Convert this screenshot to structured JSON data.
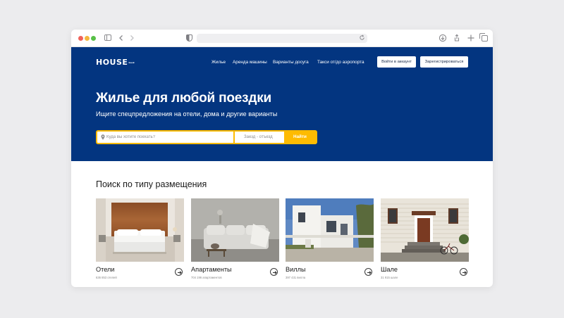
{
  "browser": {
    "icons": [
      "sidebar-icon",
      "back-icon",
      "forward-icon",
      "shield-icon",
      "reload-icon",
      "download-icon",
      "share-icon",
      "plus-icon",
      "tabs-icon"
    ]
  },
  "header": {
    "logo": "HOUSE",
    "logo_sub": "book",
    "nav": [
      "Жилье",
      "Аренда машины",
      "Варианты досуга",
      "Такси от/до аэропорта"
    ],
    "login_label": "Войти в аккаунт",
    "register_label": "Зарегистрироваться"
  },
  "hero": {
    "title": "Жилье для любой поездки",
    "subtitle": "Ищите спецпредложения на отели, дома и другие варианты"
  },
  "search": {
    "destination_placeholder": "Куда вы хотите поехать?",
    "destination_value": "",
    "dates_placeholder": "Заезд - отъезд",
    "button_label": "Найти"
  },
  "property_types": {
    "title": "Поиск по типу размещения",
    "items": [
      {
        "label": "Отели",
        "count": "636 853 отелей"
      },
      {
        "label": "Апартаменты",
        "count": "704 196 апартаментов"
      },
      {
        "label": "Виллы",
        "count": "397 431 вилла"
      },
      {
        "label": "Шале",
        "count": "31 915 шале"
      }
    ]
  },
  "colors": {
    "brand_blue": "#033580",
    "accent_yellow": "#febb02"
  }
}
